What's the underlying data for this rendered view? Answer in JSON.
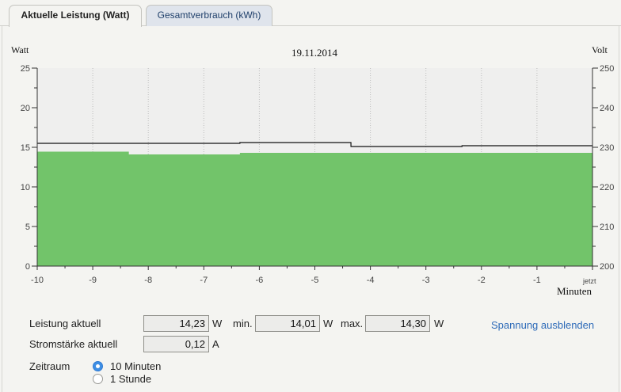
{
  "tabs": [
    {
      "label": "Aktuelle Leistung (Watt)",
      "active": true
    },
    {
      "label": "Gesamtverbrauch (kWh)",
      "active": false
    }
  ],
  "chart_data": {
    "type": "area",
    "title": "19.11.2014",
    "y_left_label": "Watt",
    "y_right_label": "Volt",
    "x_label": "Minuten",
    "x_ticks": [
      "-10",
      "-9",
      "-8",
      "-7",
      "-6",
      "-5",
      "-4",
      "-3",
      "-2",
      "-1",
      "jetzt"
    ],
    "y_left_ticks": [
      "0",
      "5",
      "10",
      "15",
      "20",
      "25"
    ],
    "y_right_ticks": [
      "200",
      "210",
      "220",
      "230",
      "240",
      "250"
    ],
    "ylim_left": [
      0,
      25
    ],
    "ylim_right": [
      200,
      250
    ],
    "xlim": [
      -10,
      0
    ],
    "colors": {
      "area": "#72c46a",
      "line": "#111111",
      "background": "#efefee",
      "grid": "#bdbdbd"
    },
    "series": [
      {
        "axis": "left",
        "kind": "area",
        "x": [
          -10,
          -8.35,
          -8.35,
          -6.35,
          -6.35,
          0
        ],
        "values": [
          14.45,
          14.45,
          14.1,
          14.1,
          14.3,
          14.3
        ]
      },
      {
        "axis": "right",
        "kind": "step-line",
        "x": [
          -10,
          -6.35,
          -6.35,
          -4.35,
          -4.35,
          -2.35,
          -2.35,
          0
        ],
        "values": [
          231.0,
          231.0,
          231.2,
          231.2,
          230.2,
          230.2,
          230.4,
          230.4
        ]
      }
    ]
  },
  "info": {
    "leistung_label": "Leistung aktuell",
    "leistung_value": "14,23",
    "leistung_unit": "W",
    "min_label": "min.",
    "min_value": "14,01",
    "min_unit": "W",
    "max_label": "max.",
    "max_value": "14,30",
    "max_unit": "W",
    "strom_label": "Stromstärke aktuell",
    "strom_value": "0,12",
    "strom_unit": "A",
    "spannung_link": "Spannung ausblenden"
  },
  "zeitraum": {
    "label": "Zeitraum",
    "options": [
      {
        "label": "10 Minuten",
        "checked": true
      },
      {
        "label": "1 Stunde",
        "checked": false
      }
    ]
  }
}
